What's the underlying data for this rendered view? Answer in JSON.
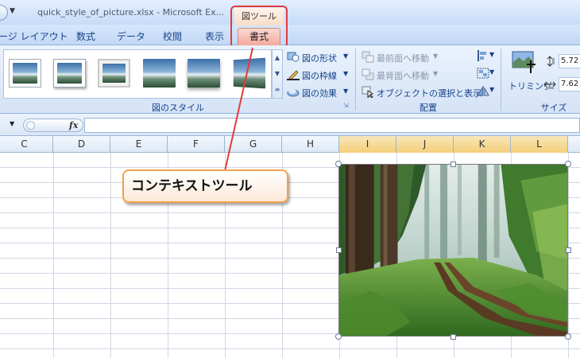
{
  "window": {
    "title": "quick_style_of_picture.xlsx - Microsoft Ex..."
  },
  "contextual_tool": {
    "group_label": "図ツール"
  },
  "tabs": [
    {
      "label": "ージ レイアウト"
    },
    {
      "label": "数式"
    },
    {
      "label": "データ"
    },
    {
      "label": "校閲"
    },
    {
      "label": "表示"
    },
    {
      "label": "書式",
      "active": true
    }
  ],
  "ribbon": {
    "picture_styles": {
      "group_label": "図のスタイル",
      "thumbnails": [
        "simple-frame-white",
        "drop-shadow",
        "thick-matte-frame",
        "soft-edge",
        "reflected",
        "perspective"
      ],
      "commands": [
        {
          "label": "図の形状",
          "icon": "shape-icon"
        },
        {
          "label": "図の枠線",
          "icon": "pencil-border-icon"
        },
        {
          "label": "図の効果",
          "icon": "effects-icon"
        }
      ]
    },
    "arrange": {
      "group_label": "配置",
      "commands": [
        {
          "label": "最前面へ移動",
          "icon": "bring-front-icon",
          "enabled": false
        },
        {
          "label": "最背面へ移動",
          "icon": "send-back-icon",
          "enabled": false
        },
        {
          "label": "オブジェクトの選択と表示",
          "icon": "selection-pane-icon",
          "enabled": true
        }
      ]
    },
    "size": {
      "group_label": "サイズ",
      "crop_label": "トリミング",
      "height": "5.72",
      "width": "7.62"
    }
  },
  "formula_bar": {
    "fx_label": "fx",
    "value": ""
  },
  "sheet": {
    "columns": [
      "C",
      "D",
      "E",
      "F",
      "G",
      "H",
      "I",
      "J",
      "K",
      "L"
    ]
  },
  "annotation": {
    "callout_text": "コンテキストツール",
    "color": "#e33b3b"
  }
}
